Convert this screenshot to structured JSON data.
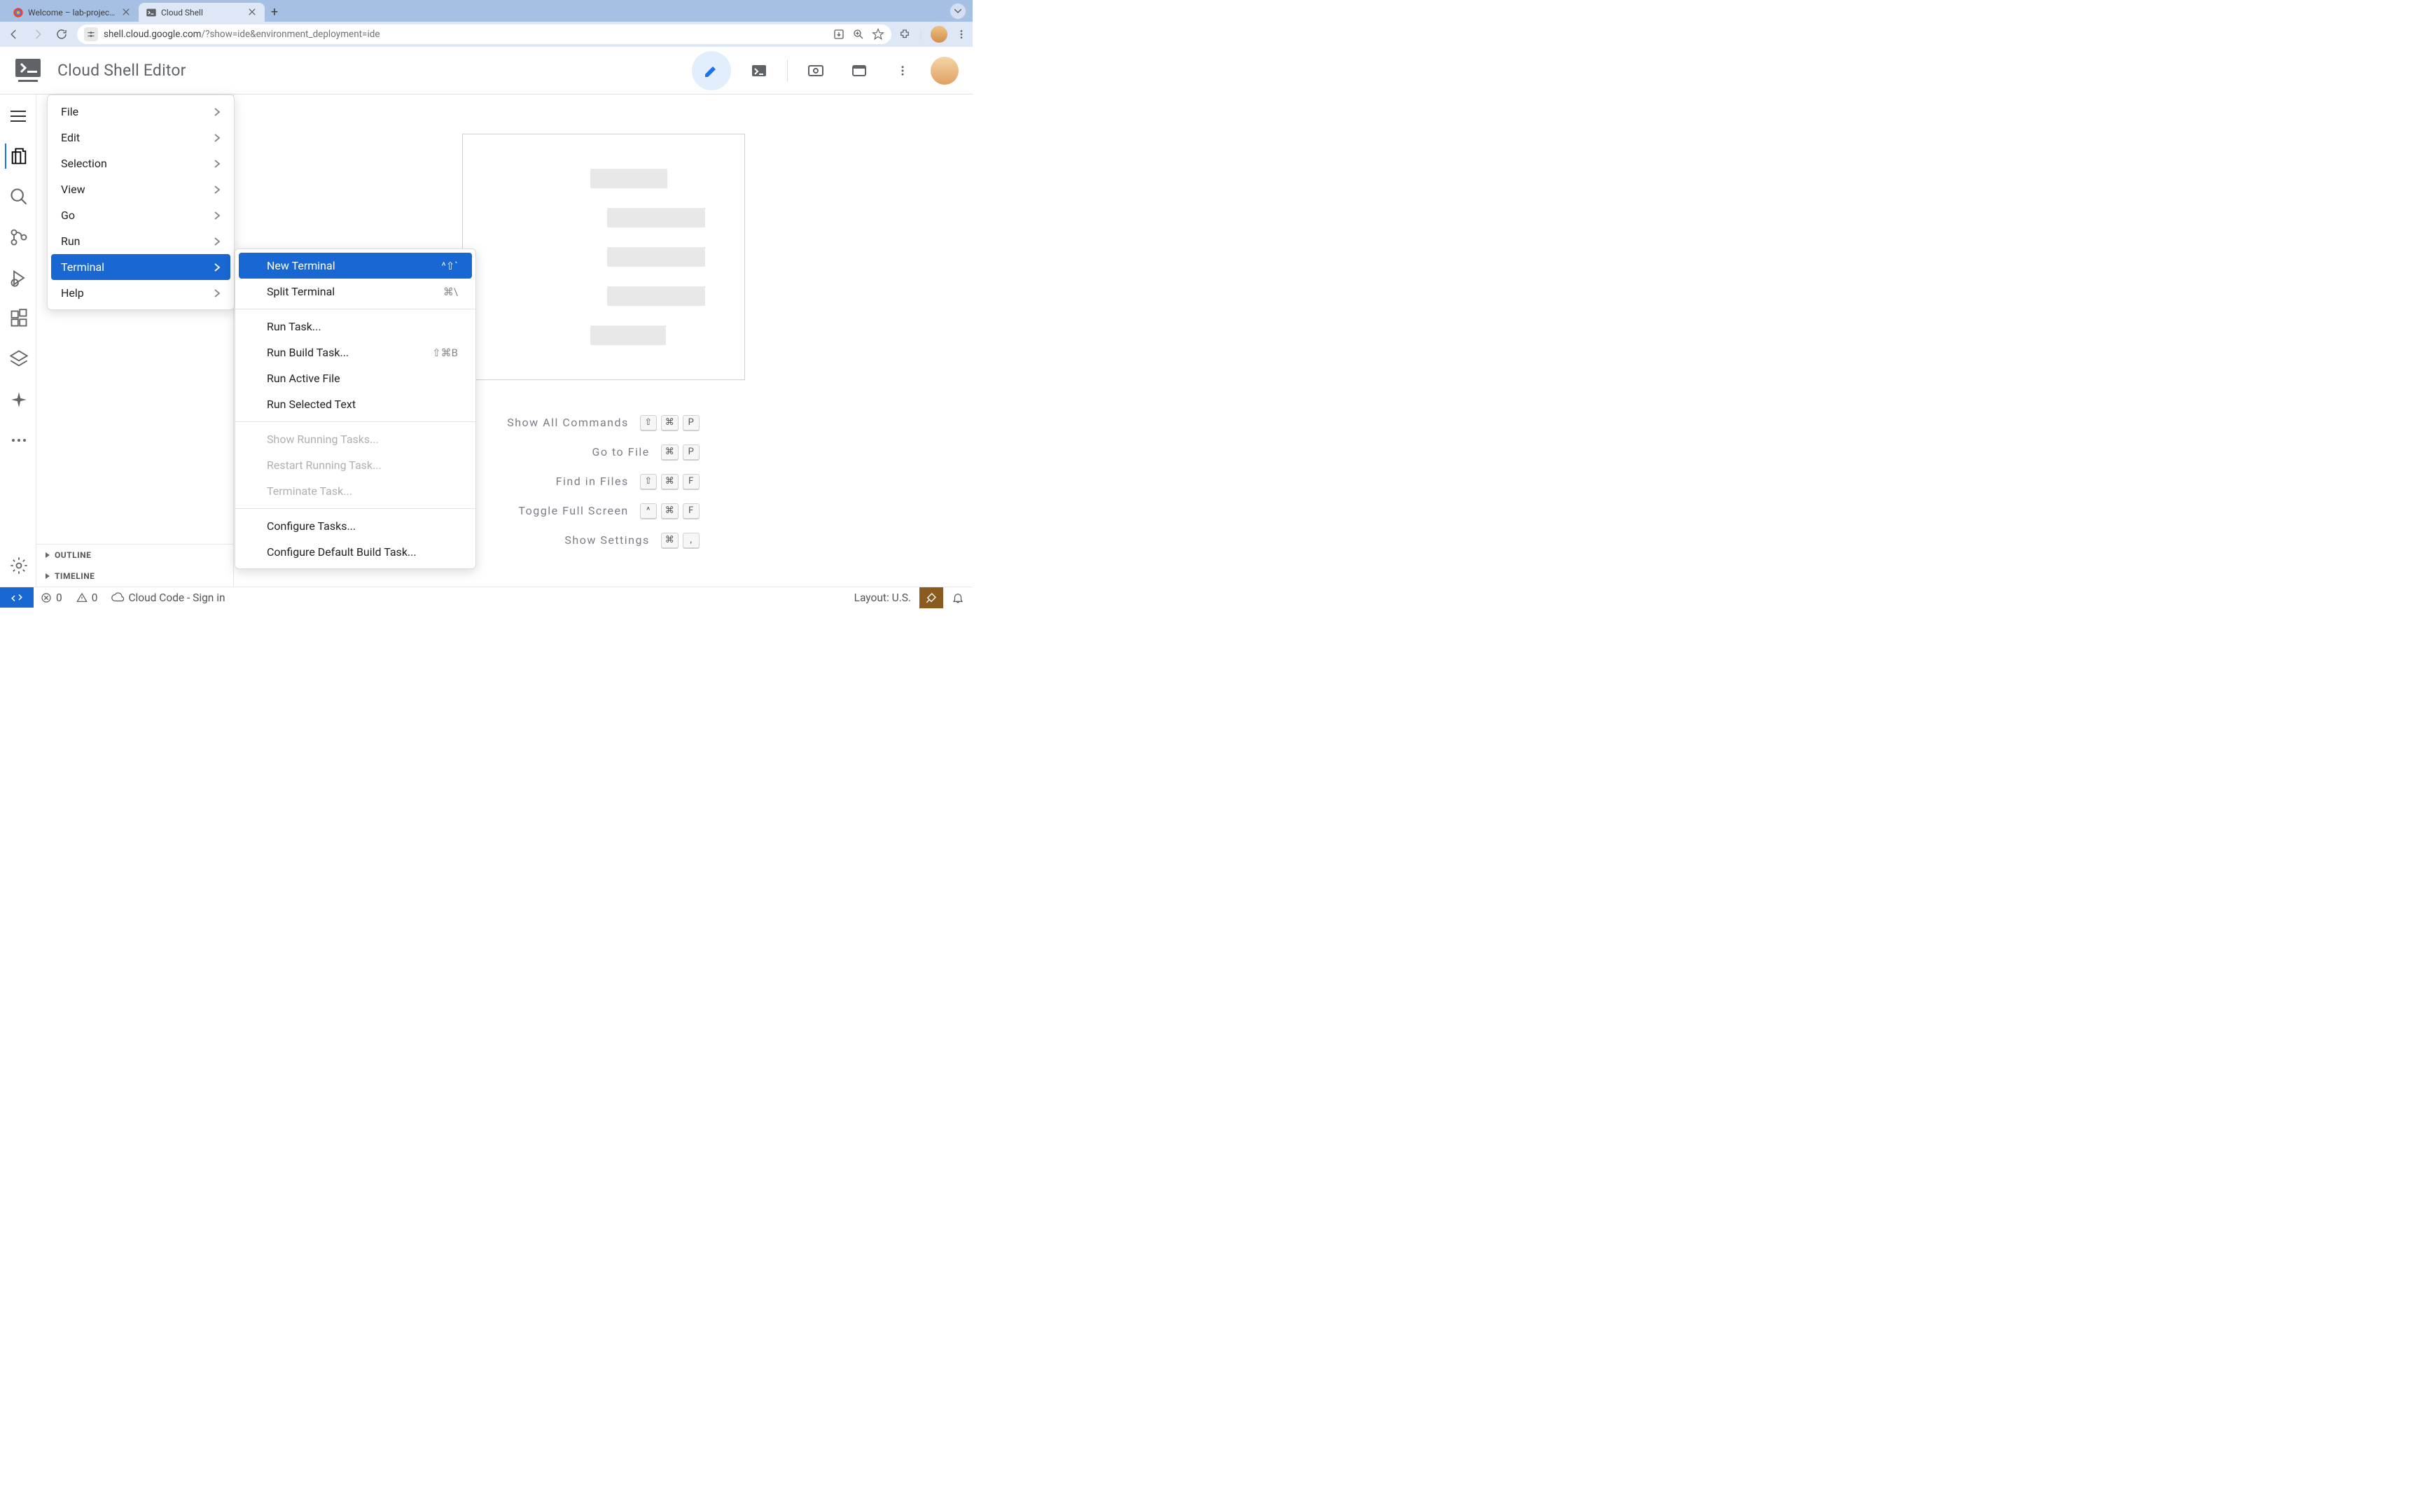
{
  "browser": {
    "tabs": [
      {
        "title": "Welcome – lab-project-id-ex",
        "active": false
      },
      {
        "title": "Cloud Shell",
        "active": true
      }
    ],
    "url_domain": "shell.cloud.google.com",
    "url_path": "/?show=ide&environment_deployment=ide"
  },
  "header": {
    "title": "Cloud Shell Editor"
  },
  "main_menu": {
    "items": [
      {
        "label": "File"
      },
      {
        "label": "Edit"
      },
      {
        "label": "Selection"
      },
      {
        "label": "View"
      },
      {
        "label": "Go"
      },
      {
        "label": "Run"
      },
      {
        "label": "Terminal",
        "highlighted": true
      },
      {
        "label": "Help"
      }
    ]
  },
  "terminal_submenu": {
    "groups": [
      [
        {
          "label": "New Terminal",
          "shortcut": "^⇧`",
          "highlighted": true
        },
        {
          "label": "Split Terminal",
          "shortcut": "⌘\\"
        }
      ],
      [
        {
          "label": "Run Task..."
        },
        {
          "label": "Run Build Task...",
          "shortcut": "⇧⌘B"
        },
        {
          "label": "Run Active File"
        },
        {
          "label": "Run Selected Text"
        }
      ],
      [
        {
          "label": "Show Running Tasks...",
          "disabled": true
        },
        {
          "label": "Restart Running Task...",
          "disabled": true
        },
        {
          "label": "Terminate Task...",
          "disabled": true
        }
      ],
      [
        {
          "label": "Configure Tasks..."
        },
        {
          "label": "Configure Default Build Task..."
        }
      ]
    ]
  },
  "shortcuts": [
    {
      "label": "Show All Commands",
      "keys": [
        "⇧",
        "⌘",
        "P"
      ]
    },
    {
      "label": "Go to File",
      "keys": [
        "⌘",
        "P"
      ]
    },
    {
      "label": "Find in Files",
      "keys": [
        "⇧",
        "⌘",
        "F"
      ]
    },
    {
      "label": "Toggle Full Screen",
      "keys": [
        "^",
        "⌘",
        "F"
      ]
    },
    {
      "label": "Show Settings",
      "keys": [
        "⌘",
        ","
      ]
    }
  ],
  "sidebar": {
    "outline": "OUTLINE",
    "timeline": "TIMELINE"
  },
  "statusbar": {
    "errors": "0",
    "warnings": "0",
    "cloud_code": "Cloud Code - Sign in",
    "layout": "Layout: U.S."
  }
}
